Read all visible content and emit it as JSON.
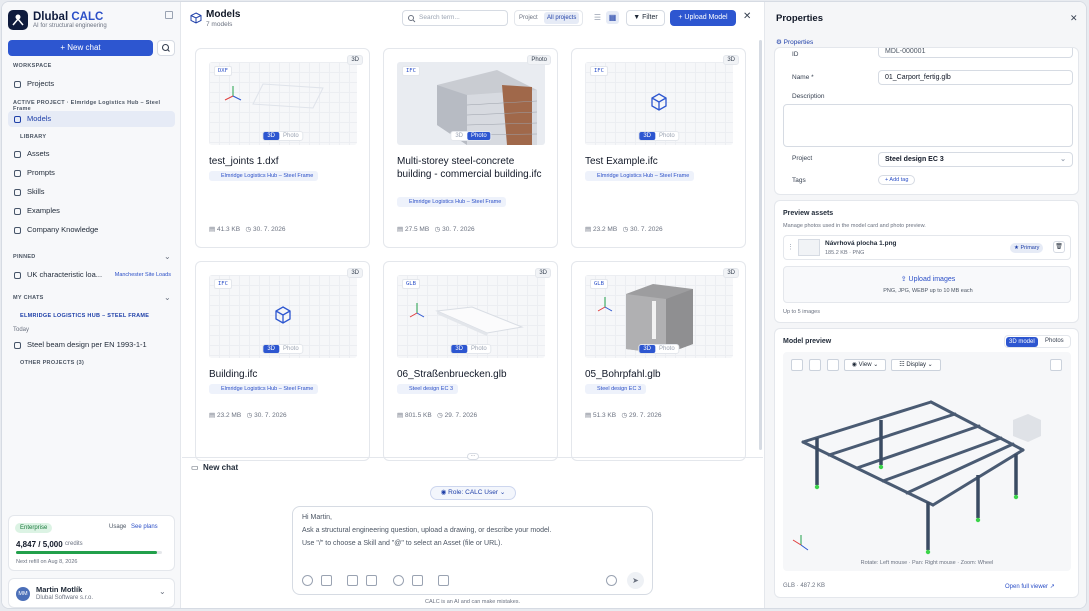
{
  "app": {
    "name_main": "Dlubal",
    "name_accent": "CALC",
    "tagline": "AI for structural engineering"
  },
  "sidebar": {
    "new_chat": "New chat",
    "workspace_label": "WORKSPACE",
    "projects": "Projects",
    "active_project_label": "ACTIVE PROJECT · Elmridge Logistics Hub – Steel Frame",
    "models": "Models",
    "library_label": "LIBRARY",
    "library_items": [
      "Assets",
      "Prompts",
      "Skills",
      "Examples",
      "Company Knowledge"
    ],
    "pinned_label": "PINNED",
    "pinned_item": "UK characteristic loa...",
    "pinned_sub": "Manchester Site Loads",
    "my_chats_label": "MY CHATS",
    "group_label": "ELMRIDGE LOGISTICS HUB – STEEL FRAME",
    "today_label": "Today",
    "chat_item": "Steel beam design per EN 1993-1-1",
    "other_projects": "OTHER PROJECTS (3)",
    "plan": "Enterprise",
    "usage_link": "Usage",
    "see_plans": "See plans",
    "credits_value": "4,847 / 5,000",
    "credits_unit": "credits",
    "credits_fraction": 0.969,
    "refill": "Next refill on Aug 8, 2026",
    "user_initials": "MM",
    "user_name": "Martin Motlík",
    "user_company": "Dlubal Software s.r.o."
  },
  "header": {
    "title": "Models",
    "subtitle": "7 models",
    "search_placeholder": "Search term...",
    "scope_project": "Project",
    "scope_all": "All projects",
    "filter": "Filter",
    "upload": "Upload Model"
  },
  "cards": [
    {
      "badge": "3D",
      "ftype": "DXF",
      "title": "test_joints 1.dxf",
      "tag": "Elmridge Logistics Hub – Steel Frame",
      "size": "41.3 KB",
      "date": "30. 7. 2026",
      "t3d": "3D",
      "tphoto": "Photo"
    },
    {
      "badge": "Photo",
      "ftype": "IFC",
      "title": "Multi-storey steel-concrete building - commercial building.ifc",
      "tag": "Elmridge Logistics Hub – Steel Frame",
      "size": "27.5 MB",
      "date": "30. 7. 2026",
      "t3d": "3D",
      "tphoto": "Photo"
    },
    {
      "badge": "3D",
      "ftype": "IFC",
      "title": "Test Example.ifc",
      "tag": "Elmridge Logistics Hub – Steel Frame",
      "size": "23.2 MB",
      "date": "30. 7. 2026",
      "t3d": "3D",
      "tphoto": "Photo"
    },
    {
      "badge": "3D",
      "ftype": "IFC",
      "title": "Building.ifc",
      "tag": "Elmridge Logistics Hub – Steel Frame",
      "size": "23.2 MB",
      "date": "30. 7. 2026",
      "t3d": "3D",
      "tphoto": "Photo"
    },
    {
      "badge": "3D",
      "ftype": "GLB",
      "title": "06_Straßenbruecken.glb",
      "tag": "Steel design EC 3",
      "size": "801.5 KB",
      "date": "29. 7. 2026",
      "t3d": "3D",
      "tphoto": "Photo"
    },
    {
      "badge": "3D",
      "ftype": "GLB",
      "title": "05_Bohrpfahl.glb",
      "tag": "Steel design EC 3",
      "size": "51.3 KB",
      "date": "29. 7. 2026",
      "t3d": "3D",
      "tphoto": "Photo"
    }
  ],
  "chat": {
    "title": "New chat",
    "role": "Role: CALC User",
    "line1": "Hi Martin,",
    "line2": "Ask a structural engineering question, upload a drawing, or describe your model.",
    "line3": "Use \"/\" to choose a Skill and \"@\" to select an Asset (file or URL).",
    "disclaimer": "CALC is an AI and can make mistakes."
  },
  "properties": {
    "title": "Properties",
    "tab": "Properties",
    "id_label": "ID",
    "id_value": "MDL-000001",
    "name_label": "Name *",
    "name_value": "01_Carport_fertig.glb",
    "description_label": "Description",
    "project_label": "Project",
    "project_value": "Steel design EC 3",
    "tags_label": "Tags",
    "add_tag": "+ Add tag",
    "preview_title": "Preview assets",
    "preview_desc": "Manage photos used in the model card and photo preview.",
    "asset_name": "Návrhová plocha 1.png",
    "asset_meta": "185.2 KB · PNG",
    "primary": "Primary",
    "upload_images": "Upload images",
    "upload_hint": "PNG, JPG, WEBP up to 10 MB each",
    "limit": "Up to 5 images",
    "model_preview": "Model preview",
    "tab_3d": "3D model",
    "tab_photos": "Photos",
    "view": "View",
    "display": "Display",
    "hint": "Rotate: Left mouse · Pan: Right mouse · Zoom: Wheel",
    "file_meta": "GLB · 487.2 KB",
    "open_viewer": "Open full viewer"
  }
}
